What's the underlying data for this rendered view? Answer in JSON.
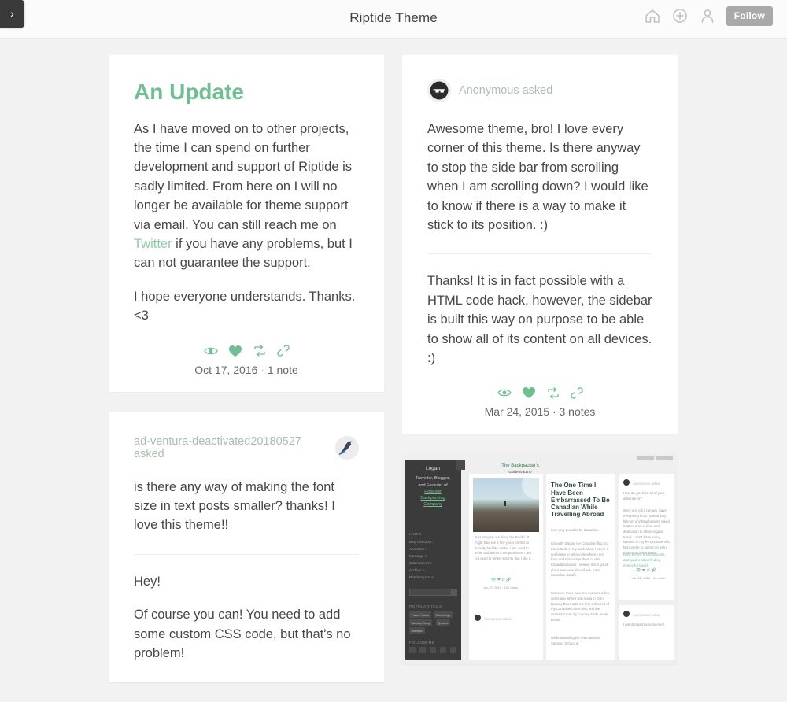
{
  "topbar": {
    "toggle_icon": "chevron-right-icon",
    "title": "Riptide Theme",
    "icons": [
      {
        "name": "home-icon"
      },
      {
        "name": "add-circle-icon"
      },
      {
        "name": "user-icon"
      }
    ],
    "follow_label": "Follow"
  },
  "theme": {
    "accent": "#6ec091",
    "accent_light": "#8ecdaa",
    "asker_color": "#a8bfb1",
    "text_color": "#474747",
    "page_bg": "#f2f2f2",
    "card_bg": "#ffffff",
    "topbar_bg": "#fbfbfb",
    "toggle_bg": "#3a3a3a",
    "follow_bg": "#a9a9a9"
  },
  "posts": {
    "update": {
      "title": "An Update",
      "paragraphs": [
        "As I have moved on to other projects, the time I can spend on further development and support of Riptide is sadly limited. From here on I will no longer be available for theme support via email. You can still reach me on ",
        "I hope everyone understands. Thanks. <3"
      ],
      "link_text": "Twitter",
      "paragraph1_tail": " if you have any problems, but I can not guarantee the support.",
      "footer_icons": [
        "eye-icon",
        "heart-icon",
        "reblog-icon",
        "link-icon"
      ],
      "meta": "Oct 17, 2016 · 1 note"
    },
    "ask_anonymous": {
      "avatar_icon": "sunglasses-avatar-icon",
      "asker": "Anonymous asked",
      "question": "Awesome theme, bro! I love every corner of this theme. Is there anyway to stop the side bar from scrolling when I am scrolling down? I would like to know if there is a way to make it stick to its position. :)",
      "answer": "Thanks! It is in fact possible with a HTML code hack, however, the sidebar is built this way on purpose to be able to show all of its content on all devices. :)",
      "footer_icons": [
        "eye-icon",
        "heart-icon",
        "reblog-icon",
        "link-icon"
      ],
      "meta": "Mar 24, 2015 · 3 notes"
    },
    "ask_adventura": {
      "avatar_icon": "bird-avatar-icon",
      "asker": "ad-ventura-deactivated20180527 asked",
      "question": "is there any way of making the font size in text posts smaller? thanks! I love this theme!!",
      "answer_greeting": "Hey!",
      "answer": "Of course you can! You need to add some custom CSS code, but that's no problem!"
    },
    "photo": {
      "preview": {
        "sidebar": {
          "blog_name": "Logan",
          "tagline_line1": "Traveller, Blogger,",
          "tagline_line2": "and Founder of",
          "links_inline": [
            "Hobbyist",
            "Backpacking",
            "Company"
          ],
          "links_label": "LINKS",
          "links": [
            "Blog Directory >",
            "About Me >",
            "Message >",
            "Submissions >",
            "Archive >",
            "Random post >"
          ],
          "tags_label": "POPULAR TAGS",
          "tags": [
            "Travel Guide",
            "Ramblings",
            "Sunday Song",
            "Quotes",
            "Random"
          ],
          "follow_label": "FOLLOW ME",
          "social_icons": [
            "instagram-icon",
            "twitter-icon",
            "pinterest-icon",
            "rss-icon",
            "telegram-icon"
          ]
        },
        "photo_post": {
          "caption": "Just hanging out along the Pacific. It might take me a few years for this to actually feel like winter. I am used to snow and below 0 temperatures, I am not used to winter warmth, but I like it.",
          "meta": "Jan 27, 2015 · 102 notes"
        },
        "article": {
          "logo_main": "The Backpacker's",
          "logo_sub": "Guide to Earth",
          "headline": "The One Time I Have Been Embarrassed To Be Canadian While Travelling Abroad",
          "p1": "I am very proud to be Canadian.",
          "p2": "I proudly display my Canadian flag on the outside of my pack when I travel. I am happy to tell people where I am from and encourage them to visit Canada because I believe it is a great place everyone should see. I am Canadian, totally.",
          "p3": "However, there was one moment a few years ago while I was living in Oslo, Norway that made me feel ashamed of my Canadian citizenship and the decisions that my country made on my behalf.",
          "p4": "While attending the International Summer School at"
        },
        "ask_column": {
          "asked1": "Anonymous asked",
          "q1": "How do you fund all of your adventures?",
          "a1": "Work any job I can get. Save everything I can. Spend very little on anything besides travel. It takes a lot of time and dedication to afford regular travel. I don't have many luxuries in my life because of it, but I prefer to spend my extra money on adventures.",
          "a1_link": "Here are my previous posts and guides about finding money for travel.",
          "meta1": "Jan 22, 2015 · 44 notes",
          "asked2": "Anonymous asked",
          "q2": "I got dumped by someone I"
        }
      }
    }
  }
}
